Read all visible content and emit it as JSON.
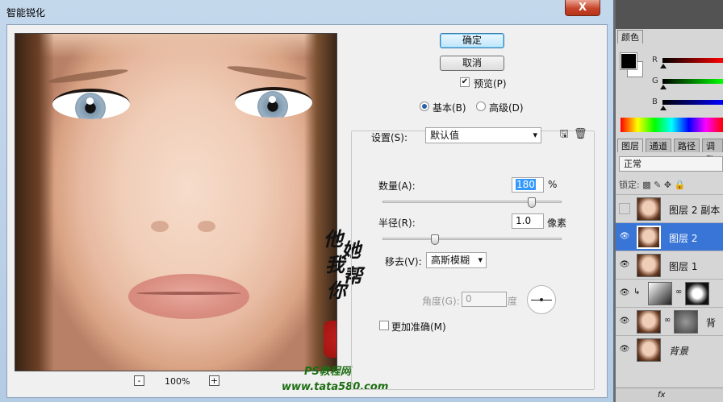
{
  "dialog": {
    "title": "智能锐化",
    "close_label": "X",
    "ok_label": "确定",
    "cancel_label": "取消",
    "preview_label": "预览(P)",
    "preview_checked": true,
    "mode_basic_label": "基本(B)",
    "mode_advanced_label": "高级(D)",
    "settings_label": "设置(S):",
    "settings_value": "默认值",
    "amount_label": "数量(A):",
    "amount_value": "180",
    "amount_unit": "%",
    "amount_level": 180,
    "amount_range": [
      1,
      500
    ],
    "radius_label": "半径(R):",
    "radius_value": "1.0",
    "radius_unit": "像素",
    "radius_level": 1.0,
    "radius_range": [
      0.1,
      64
    ],
    "remove_label": "移去(V):",
    "remove_value": "高斯模糊",
    "angle_label": "角度(G):",
    "angle_value": "0",
    "angle_unit": "度",
    "more_accurate_label": "更加准确(M)",
    "more_accurate_checked": false,
    "zoom_value": "100%",
    "zoom_out_label": "-",
    "zoom_in_label": "+",
    "watermark": {
      "chars": [
        "他",
        "她",
        "我",
        "帮",
        "你"
      ],
      "site1": "PS教程网",
      "site2": "www.tata580.com"
    }
  },
  "panels": {
    "color_tab": "颜色",
    "channels": [
      "R",
      "G",
      "B"
    ],
    "layer_tabs": [
      "图层",
      "通道",
      "路径",
      "调整"
    ],
    "blend_mode": "正常",
    "lock_label": "锁定:",
    "layers": [
      {
        "name": "图层 2 副本",
        "visible": false,
        "selected": false
      },
      {
        "name": "图层 2",
        "visible": true,
        "selected": true
      },
      {
        "name": "图层 1",
        "visible": true,
        "selected": false
      },
      {
        "name": "",
        "visible": true,
        "selected": false
      },
      {
        "name": "背",
        "visible": true,
        "selected": false
      },
      {
        "name": "背景",
        "visible": true,
        "selected": false
      }
    ],
    "bottom_label": "fx"
  },
  "colors": {
    "selection": "#3875d7",
    "ok_button": "#bee6fd",
    "watermark_green": "#1e6e14"
  }
}
